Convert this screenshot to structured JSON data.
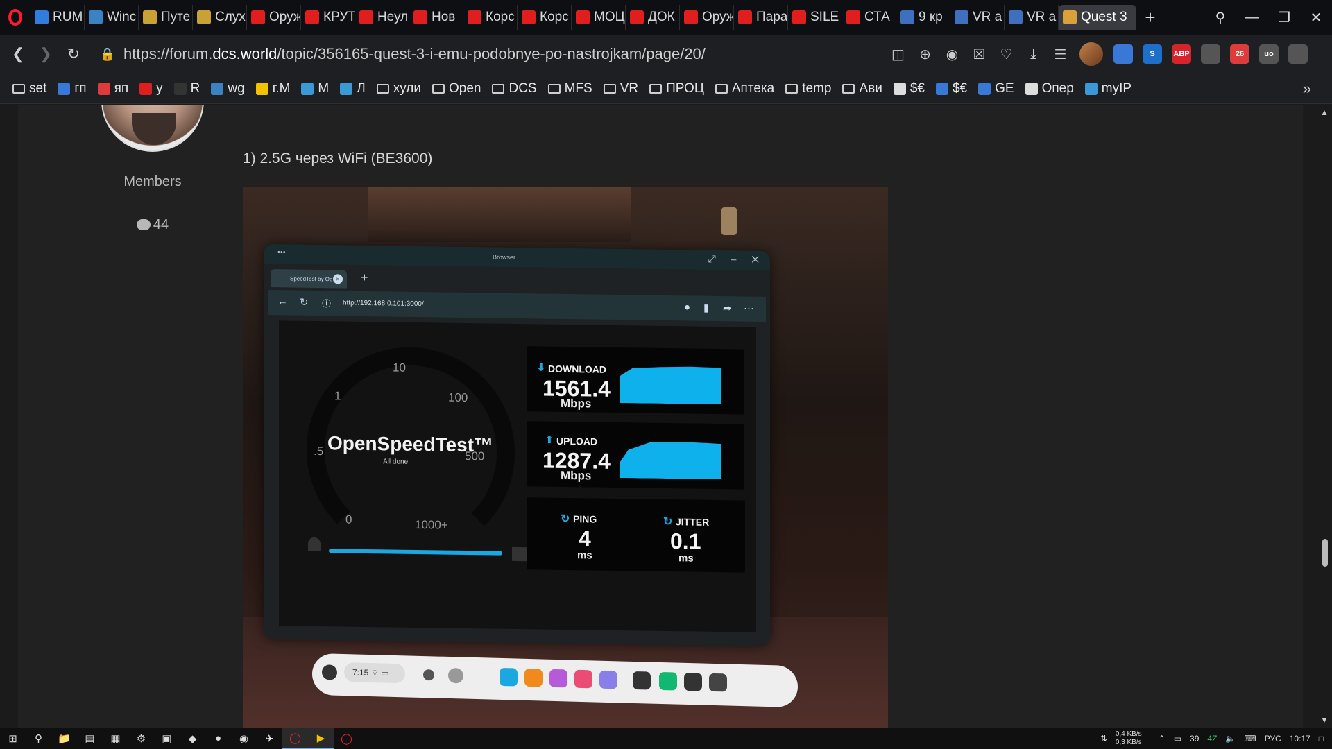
{
  "tabs": [
    {
      "label": "RUM",
      "icon": "wifi-icon",
      "color": "#2f7dde"
    },
    {
      "label": "Winc",
      "icon": "s-icon",
      "color": "#3b82c4"
    },
    {
      "label": "Путе",
      "icon": "circle-icon",
      "color": "#c9a235"
    },
    {
      "label": "Слух",
      "icon": "circle-icon",
      "color": "#c9a235"
    },
    {
      "label": "Оруж",
      "icon": "youtube-icon",
      "color": "#e01e1e"
    },
    {
      "label": "КРУТ",
      "icon": "youtube-icon",
      "color": "#e01e1e"
    },
    {
      "label": "Неул",
      "icon": "youtube-icon",
      "color": "#e01e1e"
    },
    {
      "label": "Нов",
      "icon": "youtube-icon",
      "color": "#e01e1e"
    },
    {
      "label": "Корс",
      "icon": "youtube-icon",
      "color": "#e01e1e"
    },
    {
      "label": "Корс",
      "icon": "youtube-icon",
      "color": "#e01e1e"
    },
    {
      "label": "МОЦ",
      "icon": "youtube-icon",
      "color": "#e01e1e"
    },
    {
      "label": "ДОК",
      "icon": "youtube-icon",
      "color": "#e01e1e"
    },
    {
      "label": "Оруж",
      "icon": "youtube-icon",
      "color": "#e01e1e"
    },
    {
      "label": "Пара",
      "icon": "youtube-icon",
      "color": "#e01e1e"
    },
    {
      "label": "SILE",
      "icon": "youtube-icon",
      "color": "#e01e1e"
    },
    {
      "label": "СТА",
      "icon": "youtube-icon",
      "color": "#e01e1e"
    },
    {
      "label": "9 кр",
      "icon": "4pda-icon",
      "color": "#3f6fbf"
    },
    {
      "label": "VR a",
      "icon": "4pda-icon",
      "color": "#3f6fbf"
    },
    {
      "label": "VR a",
      "icon": "4pda-icon",
      "color": "#3f6fbf"
    },
    {
      "label": "Quest 3",
      "icon": "dcs-icon",
      "color": "#d8a13a",
      "active": true
    }
  ],
  "address": {
    "prefix": "https://forum.",
    "domain": "dcs.world",
    "path": "/topic/356165-quest-3-i-emu-podobnye-po-nastrojkam/page/20/"
  },
  "extensions": [
    {
      "label": "",
      "color": "#3a78d8"
    },
    {
      "label": "S",
      "color": "#1d6fc9"
    },
    {
      "label": "ABP",
      "color": "#d9232a"
    },
    {
      "label": "",
      "color": "#555"
    },
    {
      "label": "26",
      "color": "#e03b3b"
    },
    {
      "label": "uo",
      "color": "#555"
    },
    {
      "label": "",
      "color": "#555"
    }
  ],
  "bookmarks": [
    {
      "label": "set",
      "type": "folder"
    },
    {
      "label": "гп",
      "type": "site",
      "color": "#3a78d8"
    },
    {
      "label": "яп",
      "type": "site",
      "color": "#e03b3b"
    },
    {
      "label": "у",
      "type": "site",
      "color": "#e01e1e"
    },
    {
      "label": "R",
      "type": "site",
      "color": "#333"
    },
    {
      "label": "wg",
      "type": "site",
      "color": "#3b82c4"
    },
    {
      "label": "г.М",
      "type": "site",
      "color": "#f2c200"
    },
    {
      "label": "М",
      "type": "site",
      "color": "#3a9ad8"
    },
    {
      "label": "Л",
      "type": "site",
      "color": "#3a9ad8"
    },
    {
      "label": "хули",
      "type": "folder"
    },
    {
      "label": "Open",
      "type": "folder"
    },
    {
      "label": "DCS",
      "type": "folder"
    },
    {
      "label": "MFS",
      "type": "folder"
    },
    {
      "label": "VR",
      "type": "folder"
    },
    {
      "label": "ПРОЦ",
      "type": "folder"
    },
    {
      "label": "Аптека",
      "type": "folder"
    },
    {
      "label": "temp",
      "type": "folder"
    },
    {
      "label": "Ави",
      "type": "folder"
    },
    {
      "label": "$€",
      "type": "site",
      "color": "#ddd"
    },
    {
      "label": "$€",
      "type": "site",
      "color": "#3a78d8"
    },
    {
      "label": "GE",
      "type": "site",
      "color": "#3a78d8"
    },
    {
      "label": "Опер",
      "type": "site",
      "color": "#ddd"
    },
    {
      "label": "myIP",
      "type": "site",
      "color": "#3a9ad8"
    }
  ],
  "post": {
    "role": "Members",
    "count": "44",
    "text": "1) 2.5G через WiFi (BE3600)"
  },
  "vr_browser": {
    "title": "Browser",
    "tab_label": "SpeedTest by Op",
    "url": "http://192.168.0.101:3000/"
  },
  "speedtest": {
    "title": "OpenSpeedTest™",
    "status": "All done",
    "gauge_labels": [
      "10",
      "1",
      "100",
      ".5",
      "500",
      "0",
      "1000+"
    ],
    "download": {
      "label": "DOWNLOAD",
      "value": "1561.4",
      "unit": "Mbps"
    },
    "upload": {
      "label": "UPLOAD",
      "value": "1287.4",
      "unit": "Mbps"
    },
    "ping": {
      "label": "PING",
      "value": "4",
      "unit": "ms"
    },
    "jitter": {
      "label": "JITTER",
      "value": "0.1",
      "unit": "ms"
    },
    "accent": "#0fb1ec"
  },
  "dock": {
    "time": "7:15"
  },
  "taskbar": {
    "net_down": "0,4 KB/s",
    "net_up": "0,3 KB/s",
    "battery": "39",
    "cpu": "4Z",
    "lang": "РУС",
    "time": "10:17"
  }
}
